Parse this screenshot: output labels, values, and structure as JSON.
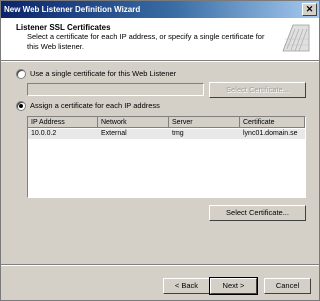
{
  "window": {
    "title": "New Web Listener Definition Wizard",
    "close_glyph": "✕"
  },
  "header": {
    "title": "Listener SSL Certificates",
    "description": "Select a certificate for each IP address, or specify a single certificate for this Web listener."
  },
  "options": {
    "single": {
      "label": "Use a single certificate for this Web Listener",
      "selected": false,
      "textbox_value": ""
    },
    "per_ip": {
      "label": "Assign a certificate for each IP address",
      "selected": true
    }
  },
  "buttons": {
    "select_certificate_single": "Select Certificate...",
    "select_certificate": "Select Certificate...",
    "back": "< Back",
    "next": "Next >",
    "cancel": "Cancel"
  },
  "table": {
    "columns": [
      "IP Address",
      "Network",
      "Server",
      "Certificate"
    ],
    "rows": [
      [
        "10.0.0.2",
        "External",
        "tmg",
        "lync01.domain.se"
      ]
    ]
  }
}
